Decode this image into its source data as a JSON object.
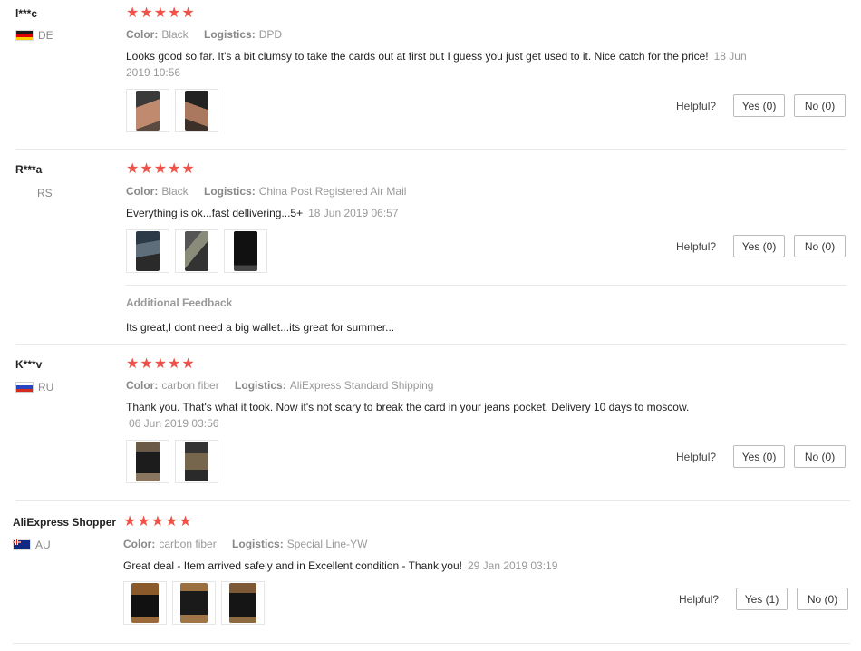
{
  "reviews": [
    {
      "user": "l***c",
      "country": "DE",
      "stars": "★★★★★",
      "color_label": "Color:",
      "color_value": "Black",
      "logistics_label": "Logistics:",
      "logistics_value": "DPD",
      "text": "Looks good so far. It's a bit clumsy to take the cards out at first but I guess you just get used to it. Nice catch for the price!",
      "date": "18 Jun 2019 10:56",
      "helpful_label": "Helpful?",
      "yes_label": "Yes (0)",
      "no_label": "No (0)"
    },
    {
      "user": "R***a",
      "country": "RS",
      "stars": "★★★★★",
      "color_label": "Color:",
      "color_value": "Black",
      "logistics_label": "Logistics:",
      "logistics_value": "China Post Registered Air Mail",
      "text": "Everything is ok...fast dellivering...5+",
      "date": "18 Jun 2019 06:57",
      "helpful_label": "Helpful?",
      "yes_label": "Yes (0)",
      "no_label": "No (0)",
      "additional_title": "Additional Feedback",
      "additional_text": "Its great,I dont need a big wallet...its great for summer..."
    },
    {
      "user": "K***v",
      "country": "RU",
      "stars": "★★★★★",
      "color_label": "Color:",
      "color_value": "carbon fiber",
      "logistics_label": "Logistics:",
      "logistics_value": "AliExpress Standard Shipping",
      "text": "Thank you. That's what it took. Now it's not scary to break the card in your jeans pocket. Delivery 10 days to moscow.",
      "date": "06 Jun 2019 03:56",
      "helpful_label": "Helpful?",
      "yes_label": "Yes (0)",
      "no_label": "No (0)"
    },
    {
      "user": "AliExpress Shopper",
      "country": "AU",
      "stars": "★★★★★",
      "color_label": "Color:",
      "color_value": "carbon fiber",
      "logistics_label": "Logistics:",
      "logistics_value": "Special Line-YW",
      "text": "Great deal - Item arrived safely and in Excellent condition - Thank you!",
      "date": "29 Jan 2019 03:19",
      "helpful_label": "Helpful?",
      "yes_label": "Yes (1)",
      "no_label": "No (0)"
    }
  ]
}
